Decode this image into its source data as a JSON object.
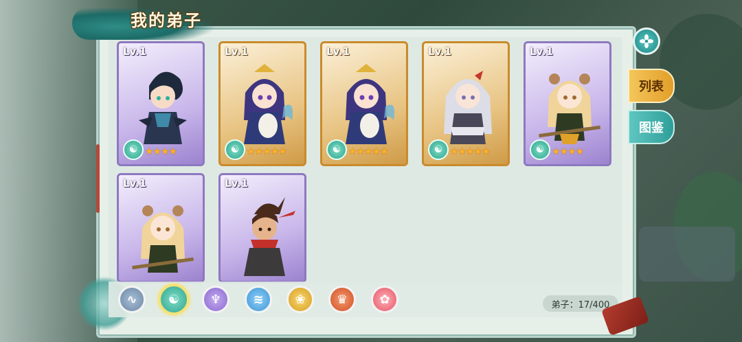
{
  "screen": {
    "title": "我的弟子",
    "tabs": [
      {
        "label": "列表",
        "active": true
      },
      {
        "label": "图鉴",
        "active": false
      }
    ],
    "close_icon": "flower-close-icon"
  },
  "cards": [
    {
      "level": "Lv.1",
      "rarity": "purple",
      "stars": "★★★★",
      "faction_icon": "yin-yang-icon",
      "character": "dark-haired-swordsman"
    },
    {
      "level": "Lv.1",
      "rarity": "gold",
      "stars": "★★★★★",
      "faction_icon": "yin-yang-icon",
      "character": "purple-haired-pipa-lady"
    },
    {
      "level": "Lv.1",
      "rarity": "gold",
      "stars": "★★★★★",
      "faction_icon": "yin-yang-icon",
      "character": "purple-haired-pipa-lady"
    },
    {
      "level": "Lv.1",
      "rarity": "gold",
      "stars": "★★★★★",
      "faction_icon": "yin-yang-icon",
      "character": "white-haired-warrior"
    },
    {
      "level": "Lv.1",
      "rarity": "purple",
      "stars": "★★★★",
      "faction_icon": "yin-yang-icon",
      "character": "blonde-staff-girl"
    },
    {
      "level": "Lv.1",
      "rarity": "purple",
      "stars": "",
      "faction_icon": "yin-yang-icon",
      "character": "blonde-staff-girl"
    },
    {
      "level": "Lv.1",
      "rarity": "purple",
      "stars": "",
      "faction_icon": "yin-yang-icon",
      "character": "red-scarf-fighter"
    }
  ],
  "filters": [
    {
      "icon": "wind-swirl-icon",
      "color": "#7e9ab8",
      "active": false
    },
    {
      "icon": "yin-yang-icon",
      "color": "#3fb8a2",
      "active": true
    },
    {
      "icon": "demon-mask-icon",
      "color": "#9a7ad6",
      "active": false
    },
    {
      "icon": "water-wave-icon",
      "color": "#4ea7e2",
      "active": false
    },
    {
      "icon": "lotus-gold-icon",
      "color": "#e4b23a",
      "active": false
    },
    {
      "icon": "flame-crown-icon",
      "color": "#e06a3a",
      "active": false
    },
    {
      "icon": "pink-lotus-icon",
      "color": "#ec6f7c",
      "active": false
    }
  ],
  "disciple_count": "弟子：17/400",
  "colors": {
    "panel_bg": "#e7efe9",
    "gold_card": "#c98b2b",
    "purple_card": "#8e78c0",
    "tab_active": "#e39e2a",
    "tab_inactive": "#2f9e99"
  }
}
